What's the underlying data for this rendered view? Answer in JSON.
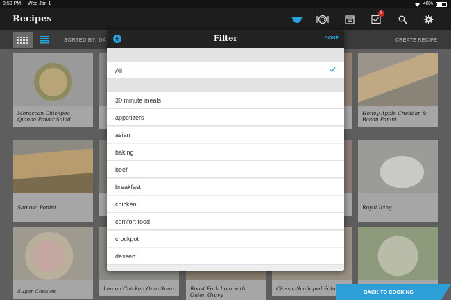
{
  "status_bar": {
    "time": "8:50 PM",
    "date": "Wed Jan 1",
    "battery": "48%"
  },
  "nav": {
    "title": "Recipes",
    "badge_count": "9"
  },
  "toolbar": {
    "sorted_by": "SORTED BY: DA",
    "create_recipe": "CREATE RECIPE"
  },
  "recipes": [
    {
      "name": "Moroccan Chickpea Quinoa Power Salad"
    },
    {
      "name": "Honey Apple Cheddar & Bacon Panini"
    },
    {
      "name": "Samosa Panini"
    },
    {
      "name": "Royal Icing"
    },
    {
      "name": "Sugar Cookies"
    },
    {
      "name": "Lemon Chicken Orzo Soup"
    },
    {
      "name": "Roast Pork Loin with Onion Gravy"
    },
    {
      "name": "Classic Scalloped Potatoes"
    }
  ],
  "filter": {
    "title": "Filter",
    "done": "DONE",
    "all": "All",
    "options": [
      "30 minute meals",
      "appetizers",
      "asian",
      "baking",
      "beef",
      "breakfast",
      "chicken",
      "comfort food",
      "crockpot",
      "dessert"
    ]
  },
  "back_to_cooking": "BACK TO COOKING",
  "colors": {
    "accent": "#2aa3dd",
    "nav_bg": "#1d1d1d",
    "badge": "#c92a2a"
  }
}
